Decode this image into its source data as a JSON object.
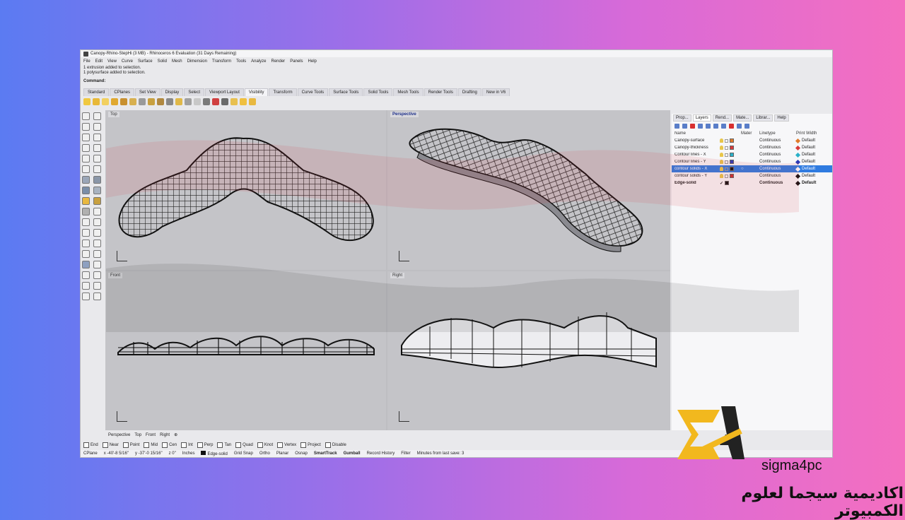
{
  "window": {
    "title": "Canopy-Rhino-StepHi (3 MB) - Rhinoceros 6 Evaluation (31 Days Remaining)"
  },
  "menu": [
    "File",
    "Edit",
    "View",
    "Curve",
    "Surface",
    "Solid",
    "Mesh",
    "Dimension",
    "Transform",
    "Tools",
    "Analyze",
    "Render",
    "Panels",
    "Help"
  ],
  "command_history": [
    "1 extrusion added to selection.",
    "1 polysurface added to selection."
  ],
  "command_prompt": "Command:",
  "toolbar_tabs": [
    "Standard",
    "CPlanes",
    "Set View",
    "Display",
    "Select",
    "Viewport Layout",
    "Visibility",
    "Transform",
    "Curve Tools",
    "Surface Tools",
    "Solid Tools",
    "Mesh Tools",
    "Render Tools",
    "Drafting",
    "New in V6"
  ],
  "active_toolbar_tab": "Visibility",
  "viewports": {
    "top": "Top",
    "perspective": "Perspective",
    "front": "Front",
    "right": "Right"
  },
  "viewport_tabs": [
    "Perspective",
    "Top",
    "Front",
    "Right"
  ],
  "osnaps": [
    "End",
    "Near",
    "Point",
    "Mid",
    "Cen",
    "Int",
    "Perp",
    "Tan",
    "Quad",
    "Knot",
    "Vertex",
    "Project",
    "Disable"
  ],
  "status": {
    "cplane": "CPlane",
    "x": "x -40'-8 5/16\"",
    "y": "y -37'-0 15/16\"",
    "z": "z 0\"",
    "units": "Inches",
    "layer": "Edge-solid",
    "items": [
      "Grid Snap",
      "Ortho",
      "Planar",
      "Osnap",
      "SmartTrack",
      "Gumball",
      "Record History",
      "Filter",
      "Minutes from last save: 3"
    ]
  },
  "panel": {
    "tabs": [
      "Prop...",
      "Layers",
      "Rend...",
      "Mate...",
      "Librar...",
      "Help"
    ],
    "active_tab": "Layers",
    "columns": {
      "name": "Name",
      "material": "Mater",
      "linetype": "Linetype",
      "print_width": "Print Width"
    },
    "layers": [
      {
        "name": "Canopy-surface",
        "color": "#e07a2a",
        "linetype": "Continuous",
        "print_width": "Default",
        "pw_color": "#e07a2a"
      },
      {
        "name": "Canopy-thickness",
        "color": "#d83a3a",
        "linetype": "Continuous",
        "print_width": "Default",
        "pw_color": "#d83a3a"
      },
      {
        "name": "Contour lines - X",
        "color": "#2ab0c8",
        "linetype": "Continuous",
        "print_width": "Default",
        "pw_color": "#2ab0c8"
      },
      {
        "name": "Contour lines - Y",
        "color": "#2a3ab8",
        "linetype": "Continuous",
        "print_width": "Default",
        "pw_color": "#2a3ab8"
      },
      {
        "name": "contour solids - X",
        "color": "#111111",
        "linetype": "Continuous",
        "print_width": "Default",
        "pw_color": "#ffffff",
        "selected": true
      },
      {
        "name": "contour solids - Y",
        "color": "#c83030",
        "linetype": "Continuous",
        "print_width": "Default",
        "pw_color": "#111111"
      },
      {
        "name": "Edge-solid",
        "color": "#111111",
        "linetype": "Continuous",
        "print_width": "Default",
        "pw_color": "#111111",
        "current": true
      }
    ]
  },
  "branding": {
    "logo_text": "sigma4pc",
    "tagline": "اكاديمية سيجما لعلوم الكمبيوتر",
    "logo_colors": {
      "primary": "#f2b81e",
      "secondary": "#222222"
    }
  },
  "colors": {
    "background_left": "#5b7bf2",
    "background_right": "#f46fc0",
    "selection": "#2f7be0"
  }
}
